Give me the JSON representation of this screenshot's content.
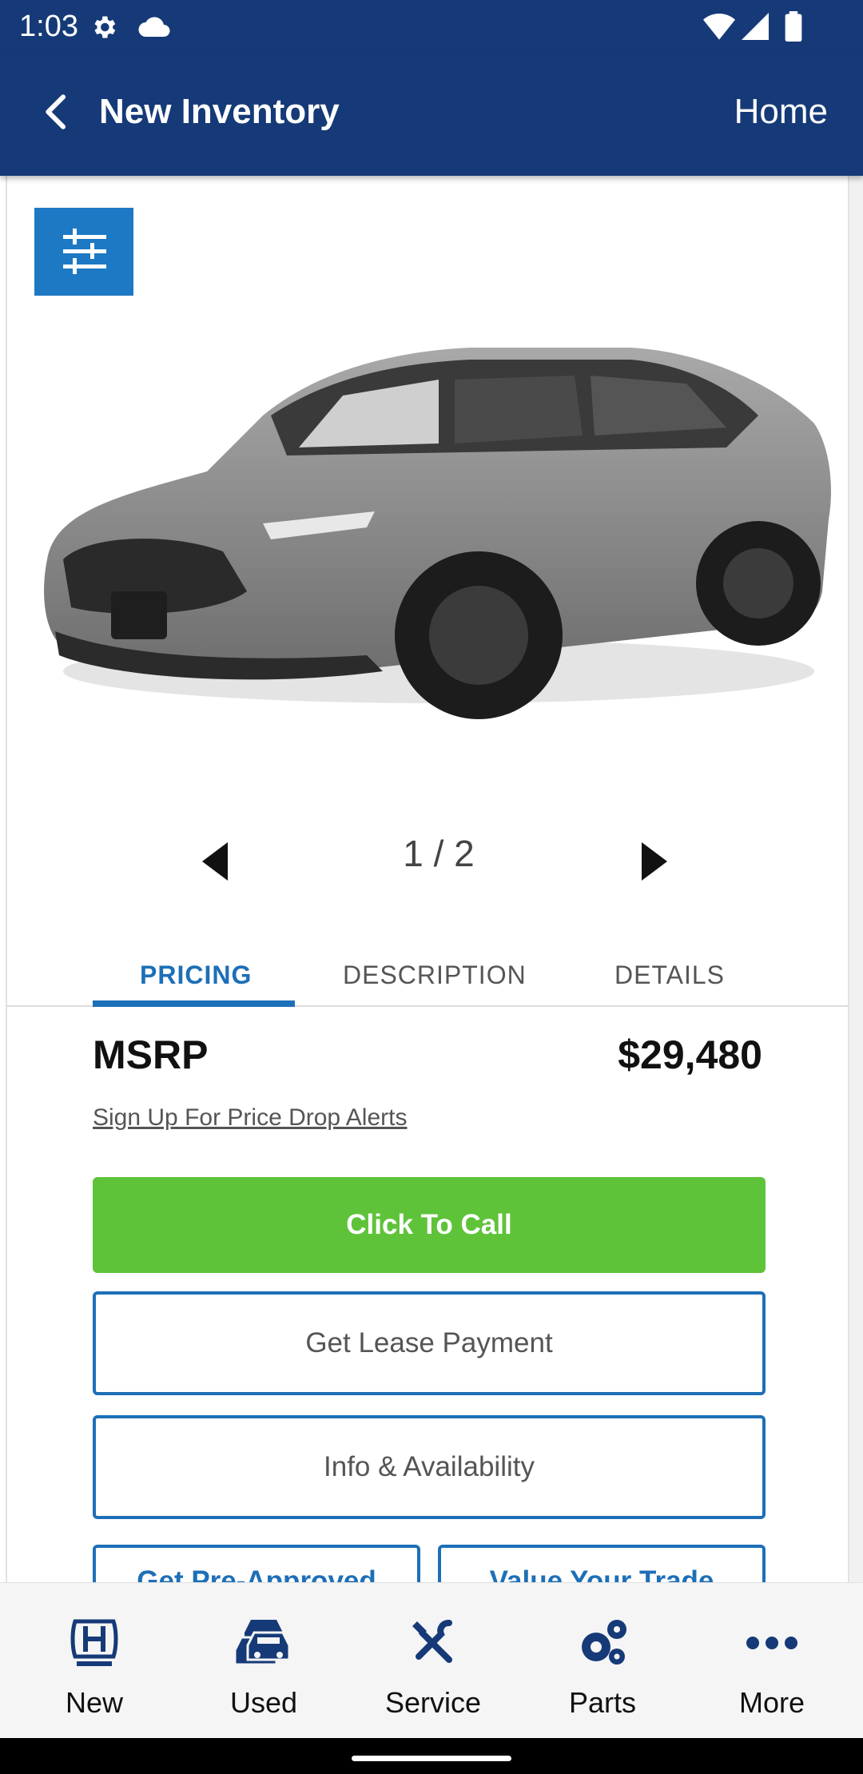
{
  "status_bar": {
    "time": "1:03"
  },
  "app_bar": {
    "title": "New Inventory",
    "home_label": "Home"
  },
  "gallery": {
    "counter": "1 / 2"
  },
  "tabs": [
    {
      "label": "PRICING",
      "selected": true
    },
    {
      "label": "DESCRIPTION",
      "selected": false
    },
    {
      "label": "DETAILS",
      "selected": false
    }
  ],
  "pricing": {
    "msrp_label": "MSRP",
    "msrp_value": "$29,480",
    "alert_link": "Sign Up For Price Drop Alerts"
  },
  "actions": {
    "call": "Click To Call",
    "lease": "Get Lease Payment",
    "info": "Info & Availability",
    "preapproved": "Get Pre-Approved",
    "trade": "Value Your Trade"
  },
  "bottom_nav": [
    {
      "label": "New",
      "icon": "honda-logo-icon"
    },
    {
      "label": "Used",
      "icon": "cars-icon"
    },
    {
      "label": "Service",
      "icon": "tools-icon"
    },
    {
      "label": "Parts",
      "icon": "gears-icon"
    },
    {
      "label": "More",
      "icon": "more-dots-icon"
    }
  ],
  "colors": {
    "header": "#163a78",
    "accent_blue": "#1d6fb7",
    "filter_blue": "#1d79c4",
    "call_green": "#5fc33a"
  }
}
